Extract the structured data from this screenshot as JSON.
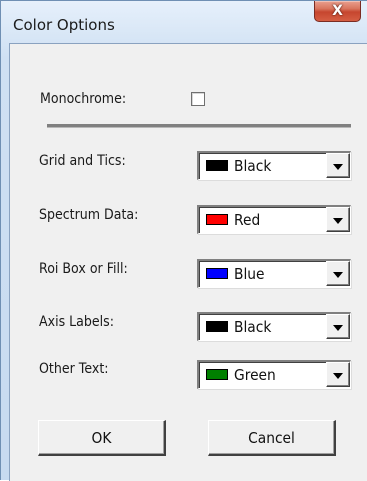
{
  "window": {
    "title": "Color Options",
    "close_glyph": "X"
  },
  "monochrome": {
    "label": "Monochrome:",
    "checked": false
  },
  "settings": [
    {
      "label": "Grid and Tics:",
      "value": "Black",
      "swatch_color": "#000000"
    },
    {
      "label": "Spectrum Data:",
      "value": "Red",
      "swatch_color": "#ff0000"
    },
    {
      "label": "Roi Box or Fill:",
      "value": "Blue",
      "swatch_color": "#0000ff"
    },
    {
      "label": "Axis Labels:",
      "value": "Black",
      "swatch_color": "#000000"
    },
    {
      "label": "Other Text:",
      "value": "Green",
      "swatch_color": "#008000"
    }
  ],
  "buttons": {
    "ok": "OK",
    "cancel": "Cancel"
  }
}
